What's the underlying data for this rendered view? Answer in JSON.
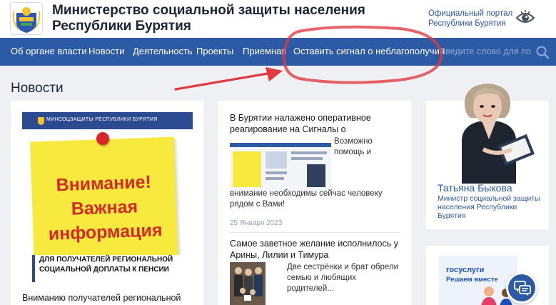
{
  "header": {
    "title": "Министерство социальной защиты населения Республики Бурятия",
    "portal_link": "Официальный портал Республики Бурятия"
  },
  "nav": {
    "items": [
      "Об органе власти",
      "Новости",
      "Деятельность",
      "Проекты",
      "Приемная",
      "Оставить сигнал о неблагополучии"
    ],
    "search_placeholder": "Введите слово для пои"
  },
  "section": {
    "title": "Новости"
  },
  "card1": {
    "image_bar_text": "МИНСОЦЗАЩИТЫ РЕСПУБЛИКИ БУРЯТИЯ",
    "note_line1": "Внимание!",
    "note_line2": "Важная",
    "note_line3": "информация",
    "caption": "ДЛЯ ПОЛУЧАТЕЛЕЙ РЕГИОНАЛЬНОЙ СОЦИАЛЬНОЙ ДОПЛАТЫ К ПЕНСИИ",
    "title": "Вниманию получателей региональной"
  },
  "card2": {
    "news": [
      {
        "title": "В Бурятии налажено оперативное реагирование на Сигналы о неблагополучии",
        "excerpt_side": "Возможно помощь и",
        "excerpt_rest": "внимание необходимы сейчас человеку рядом с Вами!",
        "date": "25 Января 2023"
      },
      {
        "title": "Самое заветное желание исполнилось у Арины, Лилии и Тимура",
        "excerpt_side": "Две сестрёнки и брат обрели семью и любящих родителей..."
      }
    ]
  },
  "minister": {
    "name": "Татьяна Быкова",
    "role": "Министр социальной защиты населения Республики Бурятия"
  },
  "gosuslugi": {
    "logo": "госуслуги",
    "tagline": "Решаем вместе"
  },
  "colors": {
    "nav_bg": "#2c5aa4",
    "link": "#2e5aa8",
    "annotation": "#e0393e",
    "note": "#f8e93f",
    "note_text": "#d32b2b"
  }
}
